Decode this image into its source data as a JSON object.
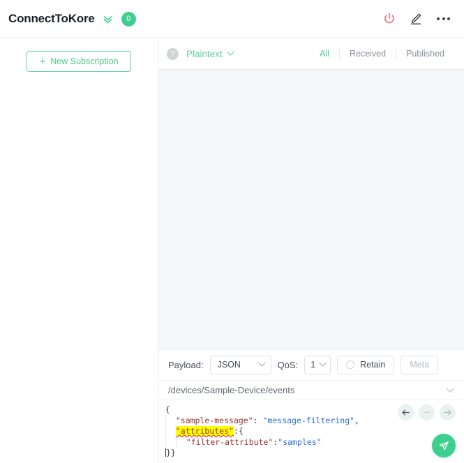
{
  "header": {
    "title": "ConnectToKore",
    "expand_icon": "chevron-double-down-icon",
    "badge_count": "0",
    "power_icon": "power-icon",
    "edit_icon": "pencil-edit-icon",
    "more_icon": "more-options-icon",
    "accent_green": "#3ecf8e",
    "power_red": "#f2676b"
  },
  "sidebar": {
    "new_subscription_label": "New Subscription",
    "plus_icon": "plus-icon"
  },
  "toolbar": {
    "help_icon": "question-mark-icon",
    "format": "Plaintext",
    "format_chevron": "chevron-down-icon",
    "filters": [
      {
        "label": "All",
        "active": true
      },
      {
        "label": "Received",
        "active": false
      },
      {
        "label": "Published",
        "active": false
      }
    ]
  },
  "messages": {
    "empty": "",
    "background": "#f6f7fa"
  },
  "composer": {
    "payload_label": "Payload:",
    "payload_value": "JSON",
    "qos_label": "QoS:",
    "qos_value": "1",
    "retain_label": "Retain",
    "retain_checked": false,
    "meta_label": "Meta",
    "meta_disabled": true,
    "topic": "/devices/Sample-Device/events",
    "topic_chevron": "chevron-down-icon"
  },
  "editor": {
    "lines": [
      "{",
      "  \"sample-message\": \"message-filtering\",",
      "  \"attributes\":{",
      "    \"filter-attribute\":\"samples\"",
      "}}"
    ],
    "line1": "{",
    "line2_key": "\"sample-message\"",
    "line2_colon": ": ",
    "line2_value": "\"message-filtering\"",
    "line2_comma": ",",
    "line3_key": "\"attributes\"",
    "line3_rest": ":{",
    "line4_key": "\"filter-attribute\"",
    "line4_colon": ":",
    "line4_value": "\"samples\"",
    "line5": "}}",
    "highlight_token": "\"attributes\"",
    "nav_back_icon": "arrow-left-icon",
    "nav_minus_icon": "minus-icon",
    "nav_forward_icon": "arrow-right-icon",
    "send_icon": "send-paper-plane-icon"
  }
}
